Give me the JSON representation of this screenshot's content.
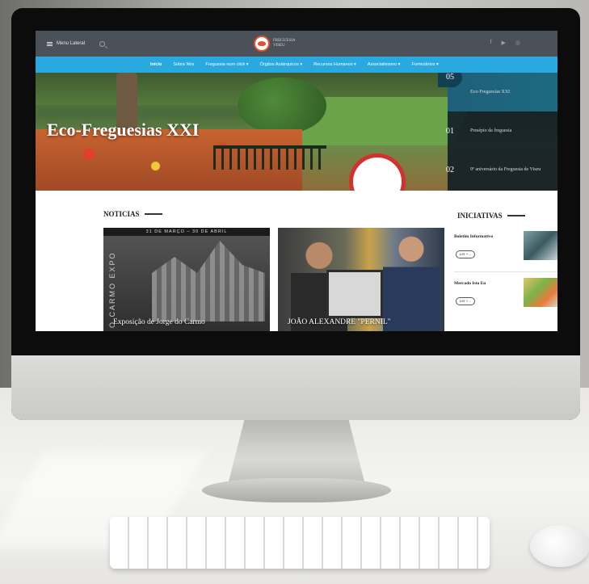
{
  "topbar": {
    "menu_label": "Menu Lateral",
    "logo_text_line1": "FREGUESIA",
    "logo_text_line2": "VISEU",
    "social_icons": [
      "facebook-icon",
      "youtube-icon",
      "instagram-icon"
    ]
  },
  "nav": {
    "items": [
      {
        "label": "Início",
        "active": true
      },
      {
        "label": "Sobre Nós"
      },
      {
        "label": "Freguesia num click ▾"
      },
      {
        "label": "Órgãos Autárquicos ▾"
      },
      {
        "label": "Recursos Humanos ▾"
      },
      {
        "label": "Associativismo ▾"
      },
      {
        "label": "Formulários ▾"
      }
    ]
  },
  "hero": {
    "title": "Eco-Freguesias XXI",
    "slides": [
      {
        "num": "05",
        "label": "Eco-Freguesias XXI",
        "active": true
      },
      {
        "num": "01",
        "label": "Presépio da freguesia"
      },
      {
        "num": "02",
        "label": "9º aniversário da Freguesia de Viseu"
      }
    ]
  },
  "news": {
    "heading": "NOTICIAS",
    "cards": [
      {
        "title": "Exposição de Jorge do Carmo",
        "banner": "31 DE MARÇO – 30 DE ABRIL",
        "side_text": "O CARMO EXPO"
      },
      {
        "title": "JOÃO ALEXANDRE \"PERNIL\""
      }
    ]
  },
  "iniciativas": {
    "heading": "INICIATIVAS",
    "items": [
      {
        "title": "Boletim Informativo",
        "button": "Ler +..."
      },
      {
        "title": "Mercado Isto Eu",
        "button": "Ler +..."
      }
    ]
  },
  "colors": {
    "topbar": "#4a5158",
    "nav": "#29a9e0",
    "hero_panel": "#141e26",
    "hero_active": "#1f5f7a",
    "logo_accent": "#e0502f"
  }
}
